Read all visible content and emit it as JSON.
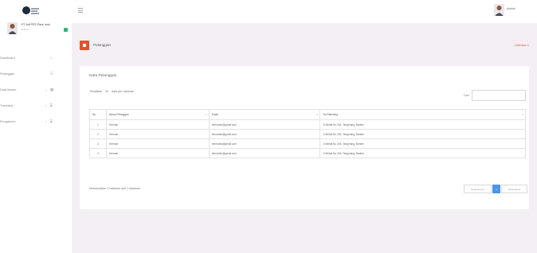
{
  "sidebar": {
    "user": {
      "name": "PT Adi PPS Pack Indo",
      "role": "Admin"
    },
    "menu": [
      {
        "label": "Dashboard",
        "icon": "home-icon",
        "glyph": "⌂",
        "has_submenu": false
      },
      {
        "label": "Pelanggan",
        "icon": "users-icon",
        "glyph": "☷",
        "has_submenu": false
      },
      {
        "label": "Data Master",
        "icon": "grid-icon",
        "glyph": "▦",
        "has_submenu": true,
        "chevron": "‹"
      },
      {
        "label": "Transaksi",
        "icon": "cart-icon",
        "glyph": "⌸",
        "has_submenu": true,
        "chevron": "‹"
      },
      {
        "label": "Pengaturan",
        "icon": "settings-icon",
        "glyph": "⌸",
        "has_submenu": true,
        "chevron": "‹"
      }
    ]
  },
  "topbar": {
    "user_name": "Admin"
  },
  "page": {
    "title": "Pelanggan",
    "overview": "Overview ⊙"
  },
  "card": {
    "title": "Data Pelanggan",
    "show_prefix": "Tampilkan",
    "show_value": "10",
    "show_suffix": "data per halaman",
    "search_label": "Cari",
    "search_value": ""
  },
  "table": {
    "headers": [
      "No",
      "Nama Pelanggan",
      "Email",
      "No Rekening"
    ],
    "rows": [
      {
        "no": "1",
        "name": "Herman",
        "email": "hermanto@gmail.com",
        "account": "Jl Melati No 204, Tangerang, Banten"
      },
      {
        "no": "2",
        "name": "Herman",
        "email": "hermanto@gmail.com",
        "account": "Jl Melati No 204, Tangerang, Banten"
      },
      {
        "no": "3",
        "name": "Herman",
        "email": "hermanto@gmail.com",
        "account": "Jl Melati No 204, Tangerang, Banten"
      },
      {
        "no": "4",
        "name": "Herman",
        "email": "hermanto@gmail.com",
        "account": "Jl Melati No 204, Tangerang, Banten"
      }
    ]
  },
  "footer": {
    "info": "Menampilkan 1 halaman dari 1 halaman",
    "prev": "Sebelumnya",
    "page": "1",
    "next": "Selanjutnya"
  },
  "colors": {
    "accent": "#ee4b2b",
    "pager_active": "#4a97e6",
    "status_online": "#2bb673",
    "background": "#f3eff4"
  }
}
